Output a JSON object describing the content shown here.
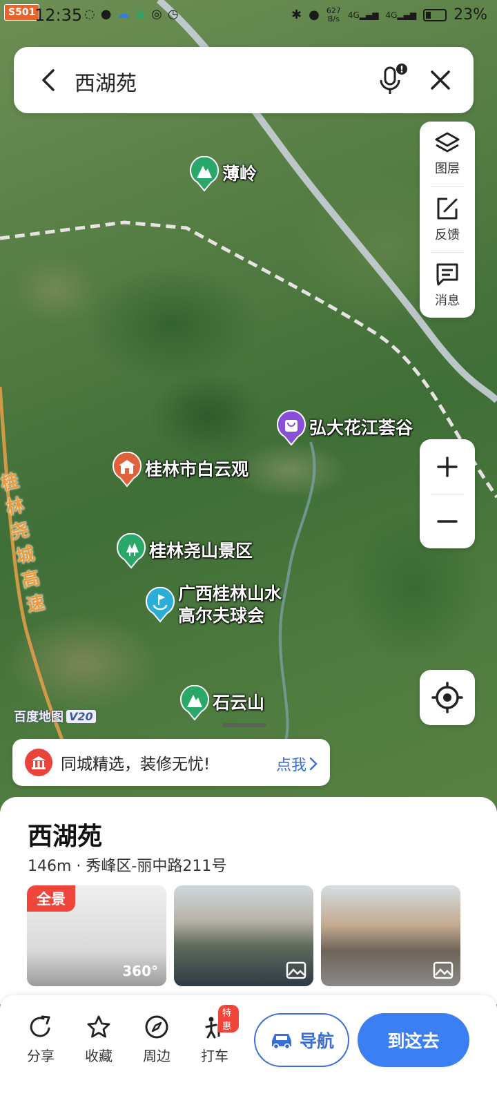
{
  "status_bar": {
    "badge": "S501",
    "time": "12:35",
    "net_speed": "627\nB/s",
    "signal1": "4G",
    "signal2": "4G",
    "battery": "23%"
  },
  "search": {
    "query": "西湖苑"
  },
  "map_tools": {
    "layers": "图层",
    "feedback": "反馈",
    "messages": "消息"
  },
  "pois": [
    {
      "name": "薄岭",
      "type": "mountain",
      "color": "#2aa86a"
    },
    {
      "name": "弘大花江荟谷",
      "type": "shopping",
      "color": "#8a4fd8"
    },
    {
      "name": "桂林市白云观",
      "type": "temple",
      "color": "#e0623a"
    },
    {
      "name": "桂林尧山景区",
      "type": "scenic",
      "color": "#2aa86a"
    },
    {
      "name": "广西桂林山水",
      "name2": "高尔夫球会",
      "type": "golf",
      "color": "#2aaed6"
    },
    {
      "name": "石云山",
      "type": "mountain",
      "color": "#2aa86a"
    }
  ],
  "road_label": [
    "桂",
    "林",
    "尧",
    "城",
    "高",
    "速"
  ],
  "watermark": {
    "text": "百度地图",
    "version": "V20"
  },
  "promo": {
    "text": "同城精选，装修无忧!",
    "link": "点我"
  },
  "place": {
    "name": "西湖苑",
    "subtitle": "146m · 秀峰区-丽中路211号",
    "pano_label": "全景",
    "pano_360": "360°"
  },
  "actions": {
    "share": "分享",
    "favorite": "收藏",
    "nearby": "周边",
    "taxi": "打车",
    "taxi_badge": "特惠",
    "navigate": "导航",
    "go_here": "到这去"
  },
  "colors": {
    "accent_blue": "#3b7ff2",
    "link_blue": "#3b6fd6",
    "highway_orange": "#e89a3c"
  }
}
